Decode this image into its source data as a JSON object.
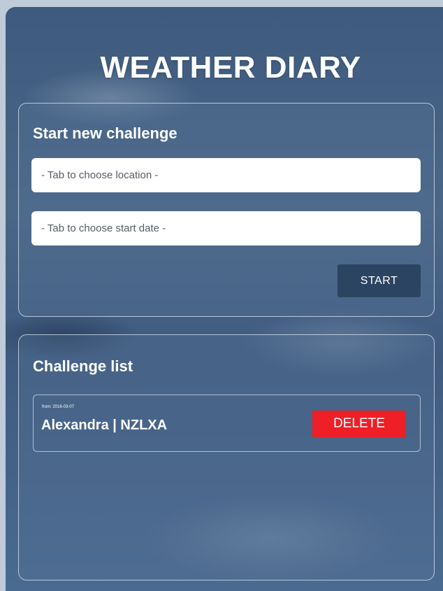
{
  "app": {
    "title": "WEATHER DIARY"
  },
  "new_challenge": {
    "heading": "Start new challenge",
    "location_placeholder": "- Tab to choose location -",
    "date_placeholder": "- Tab to choose start date -",
    "start_label": "START"
  },
  "challenge_list": {
    "heading": "Challenge list",
    "items": [
      {
        "date": "from: 2016-03-07",
        "title": "Alexandra | NZLXA",
        "delete_label": "DELETE"
      }
    ]
  },
  "colors": {
    "background": "#4a6688",
    "start_button": "#2b4461",
    "delete_button": "#ee1f26"
  }
}
